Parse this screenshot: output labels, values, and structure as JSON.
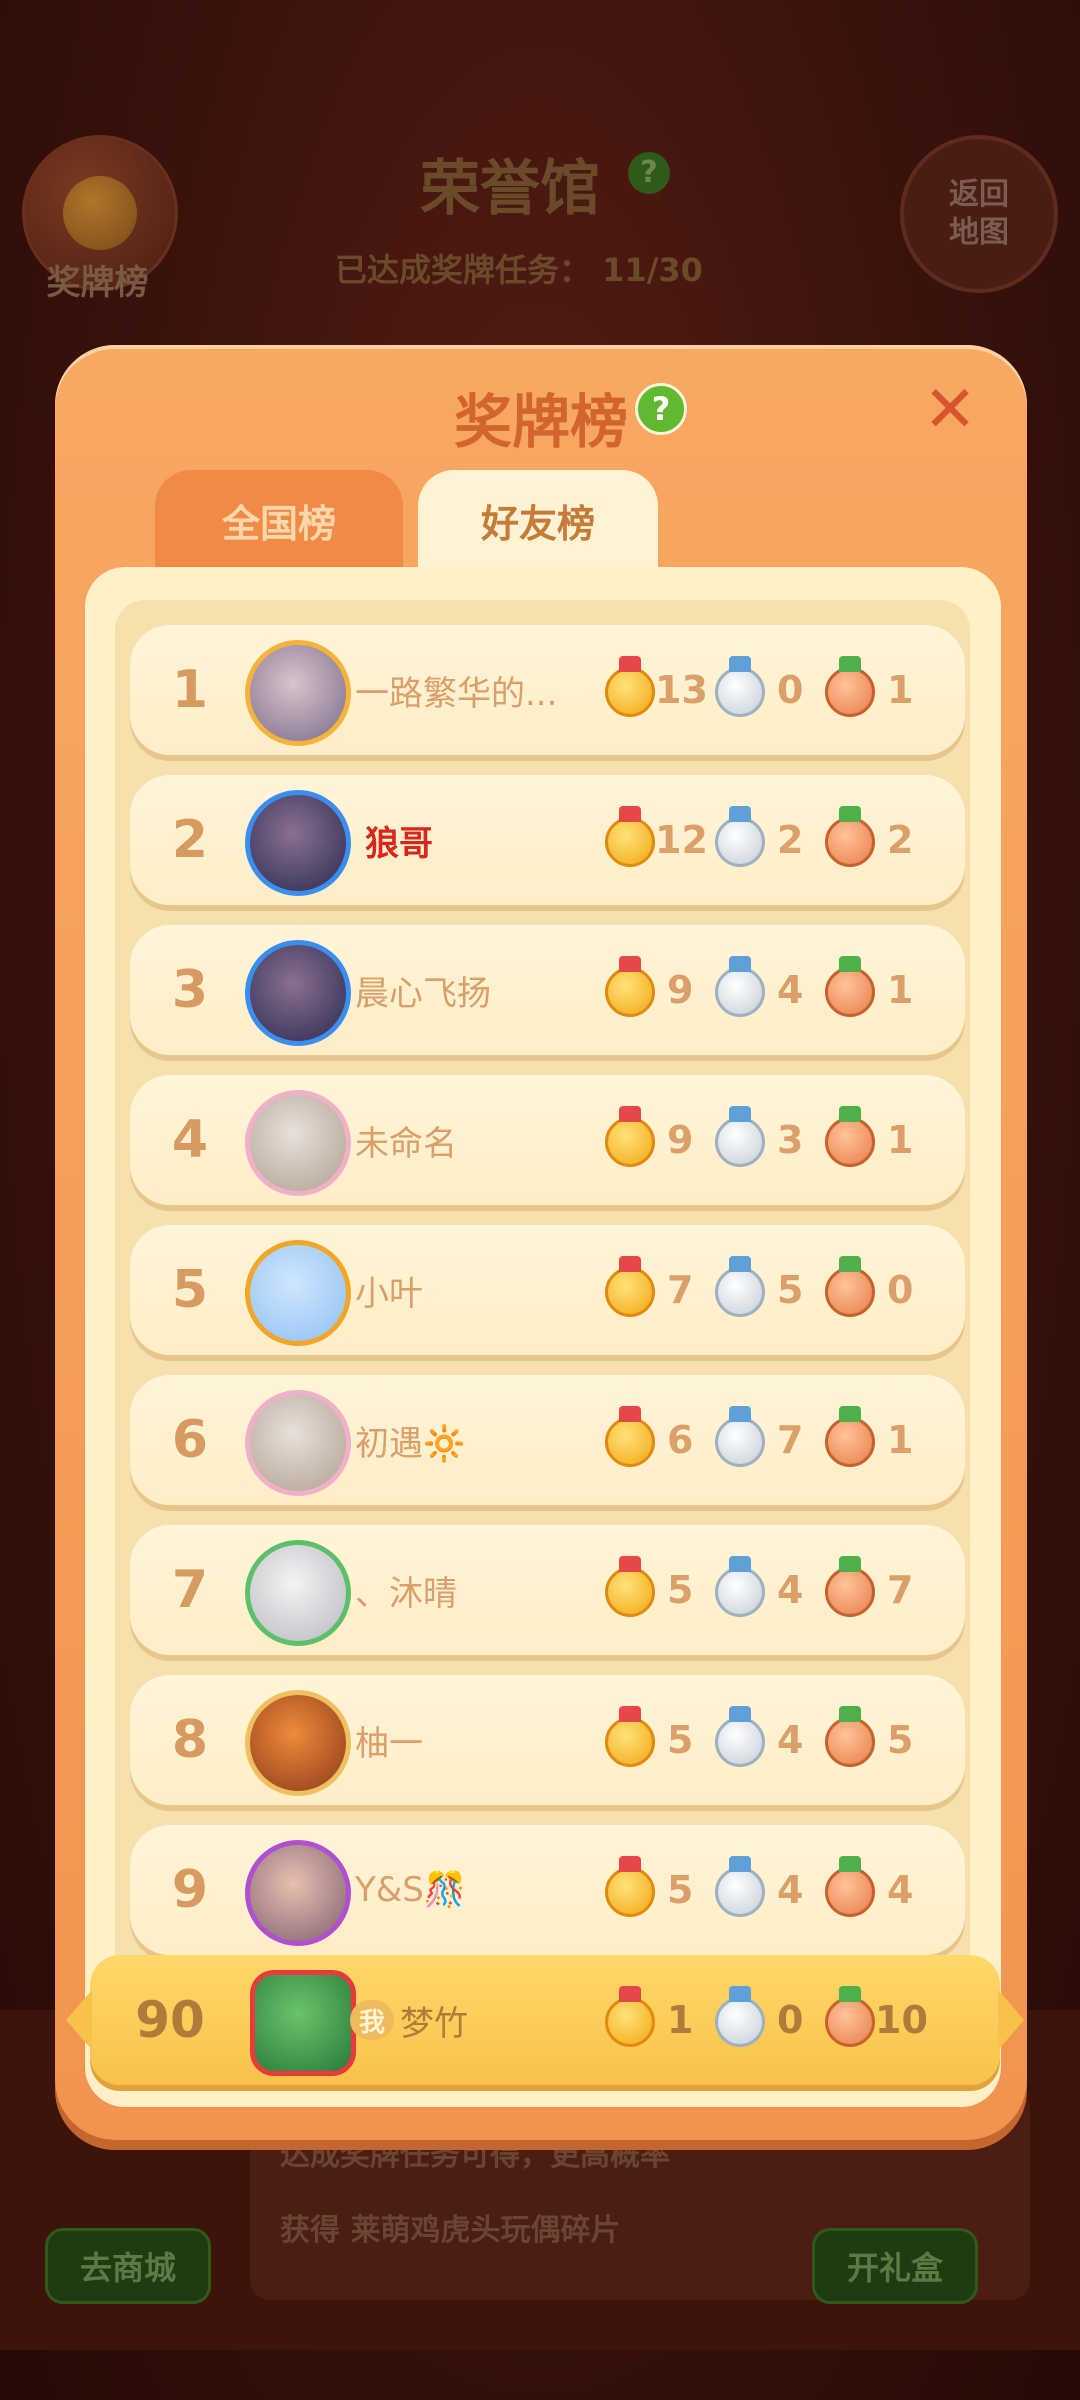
{
  "background": {
    "hall_title": "荣誉馆",
    "help_icon_label": "?",
    "medal_board_button_label": "奖牌榜",
    "back_button_label": "返回\n地图",
    "progress_label": "已达成奖牌任务：",
    "progress_value": "11/30",
    "info_text_1": "达成奖牌任务可得，更高概率",
    "info_text_2_prefix": "获得",
    "info_text_2_item": "莱萌鸡虎头玩偶碎片",
    "shop_button_label": "去商城",
    "gift_button_label": "开礼盒"
  },
  "modal": {
    "title": "奖牌榜",
    "help_icon_label": "?",
    "close_icon_label": "✕",
    "tabs": [
      {
        "label": "全国榜",
        "active": false
      },
      {
        "label": "好友榜",
        "active": true
      }
    ]
  },
  "leaderboard": [
    {
      "rank": "1",
      "name": "一路繁华的...",
      "gold": "13",
      "silver": "0",
      "bronze": "1",
      "avatar": "rose-avatar"
    },
    {
      "rank": "2",
      "name": "狼哥",
      "gold": "12",
      "silver": "2",
      "bronze": "2",
      "avatar": "dark-portrait-avatar"
    },
    {
      "rank": "3",
      "name": "晨心飞扬",
      "gold": "9",
      "silver": "4",
      "bronze": "1",
      "avatar": "waterfall-avatar"
    },
    {
      "rank": "4",
      "name": "未命名",
      "gold": "9",
      "silver": "3",
      "bronze": "1",
      "avatar": "default-avatar"
    },
    {
      "rank": "5",
      "name": "小叶",
      "gold": "7",
      "silver": "5",
      "bronze": "0",
      "avatar": "rainbow-frame-avatar"
    },
    {
      "rank": "6",
      "name": "初遇🔆",
      "gold": "6",
      "silver": "7",
      "bronze": "1",
      "avatar": "bw-avatar"
    },
    {
      "rank": "7",
      "name": "、沐晴",
      "gold": "5",
      "silver": "4",
      "bronze": "7",
      "avatar": "girl-avatar"
    },
    {
      "rank": "8",
      "name": "柚一",
      "gold": "5",
      "silver": "4",
      "bronze": "5",
      "avatar": "bear-avatar"
    },
    {
      "rank": "9",
      "name": "Y&S🎊",
      "gold": "5",
      "silver": "4",
      "bronze": "4",
      "avatar": "selfie-avatar"
    }
  ],
  "my_entry": {
    "rank": "90",
    "me_badge": "我",
    "name": "梦竹",
    "gold": "1",
    "silver": "0",
    "bronze": "10",
    "avatar": "mickey-clover-avatar"
  }
}
